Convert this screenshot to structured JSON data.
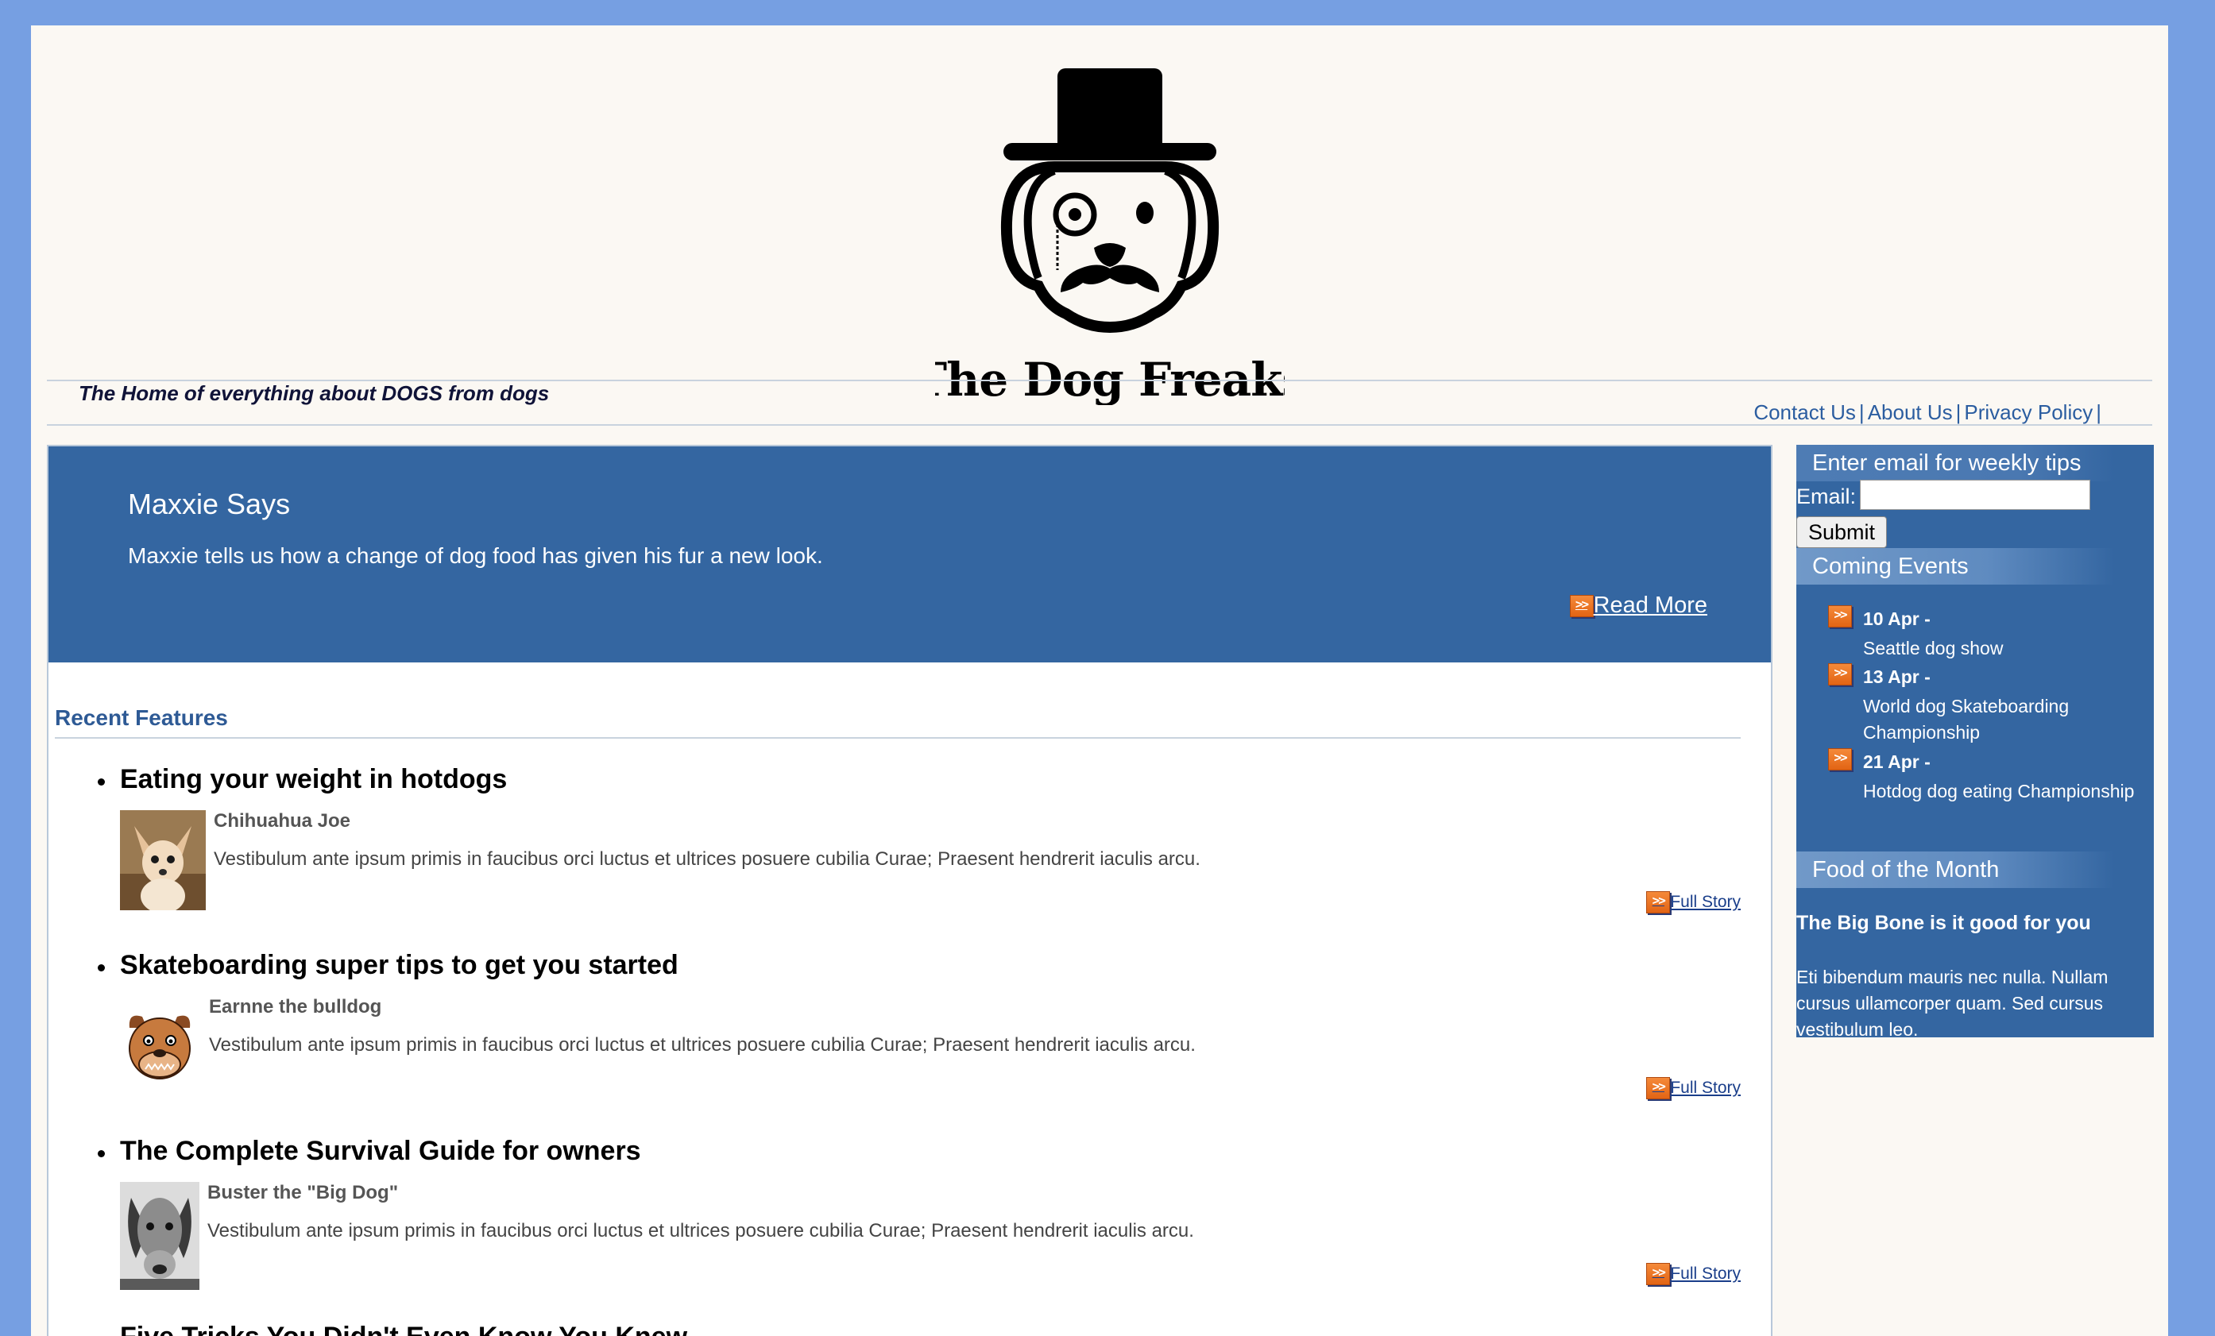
{
  "header": {
    "logo_text": "The Dog Freaks",
    "tagline": "The Home of everything about DOGS from dogs",
    "links": [
      "Contact Us",
      "About Us",
      "Privacy Policy"
    ],
    "link_separator": "|"
  },
  "hero": {
    "title": "Maxxie Says",
    "text": "Maxxie tells us how a change of dog food has given his fur a new look.",
    "link_label": "Read More",
    "link_icon": ">>"
  },
  "recent_features": {
    "heading": "Recent Features",
    "items": [
      {
        "title": "Eating your weight in hotdogs",
        "author": "Chihuahua Joe",
        "body": "Vestibulum ante ipsum primis in faucibus orci luctus et ultrices posuere cubilia Curae; Praesent hendrerit iaculis arcu.",
        "link_label": "Full Story",
        "thumb_icon": "chihuahua-photo"
      },
      {
        "title": "Skateboarding super tips to get you started",
        "author": "Earnne the bulldog",
        "body": "Vestibulum ante ipsum primis in faucibus orci luctus et ultrices posuere cubilia Curae; Praesent hendrerit iaculis arcu.",
        "link_label": "Full Story",
        "thumb_icon": "bulldog-cartoon"
      },
      {
        "title": "The Complete Survival Guide for owners",
        "author": "Buster the \"Big Dog\"",
        "body": "Vestibulum ante ipsum primis in faucibus orci luctus et ultrices posuere cubilia Curae; Praesent hendrerit iaculis arcu.",
        "link_label": "Full Story",
        "thumb_icon": "dog-bw-photo"
      },
      {
        "title": "Five Tricks You Didn't Even Know You Knew"
      }
    ]
  },
  "sidebar": {
    "newsletter": {
      "heading": "Enter email for weekly tips",
      "email_label": "Email:",
      "email_value": "",
      "submit_label": "Submit"
    },
    "events": {
      "heading": "Coming Events",
      "items": [
        {
          "date": "10 Apr -",
          "name": "Seattle dog show"
        },
        {
          "date": "13 Apr -",
          "name": "World dog Skateboarding Championship"
        },
        {
          "date": "21 Apr -",
          "name": "Hotdog dog eating Championship"
        }
      ]
    },
    "food": {
      "heading": "Food of the Month",
      "title": "The Big Bone is it good for you",
      "text": "Eti bibendum mauris nec nulla. Nullam cursus ullamcorper quam. Sed cursus vestibulum leo."
    }
  },
  "colors": {
    "outer_background": "#769fe2",
    "page_background": "#fbf8f3",
    "accent_blue": "#3466a1",
    "link_blue": "#2b5da0",
    "badge_orange": "#e26414"
  }
}
